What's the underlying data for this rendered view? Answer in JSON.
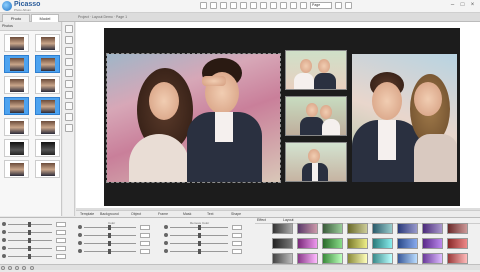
{
  "app": {
    "name": "Picasso",
    "tagline": "Photo Album"
  },
  "toolbar": {
    "zoom_label": "Page"
  },
  "tabs": [
    {
      "label": "Photo"
    },
    {
      "label": "Model"
    }
  ],
  "breadcrumb": "Project · Layout Demo · Page 1",
  "left_panel": {
    "header": "Photos"
  },
  "bottom_tabs": [
    "Template",
    "Background",
    "Object",
    "Frame",
    "Mask",
    "Text",
    "Shape"
  ],
  "effects_tabs": [
    "Effect",
    "Layout"
  ],
  "slider_labels": [
    "Color",
    "Remove Color"
  ],
  "colors": {
    "accent": "#2f7fd0",
    "selected_thumb": "#4da3f0",
    "album_bg": "#1c1c1c"
  }
}
